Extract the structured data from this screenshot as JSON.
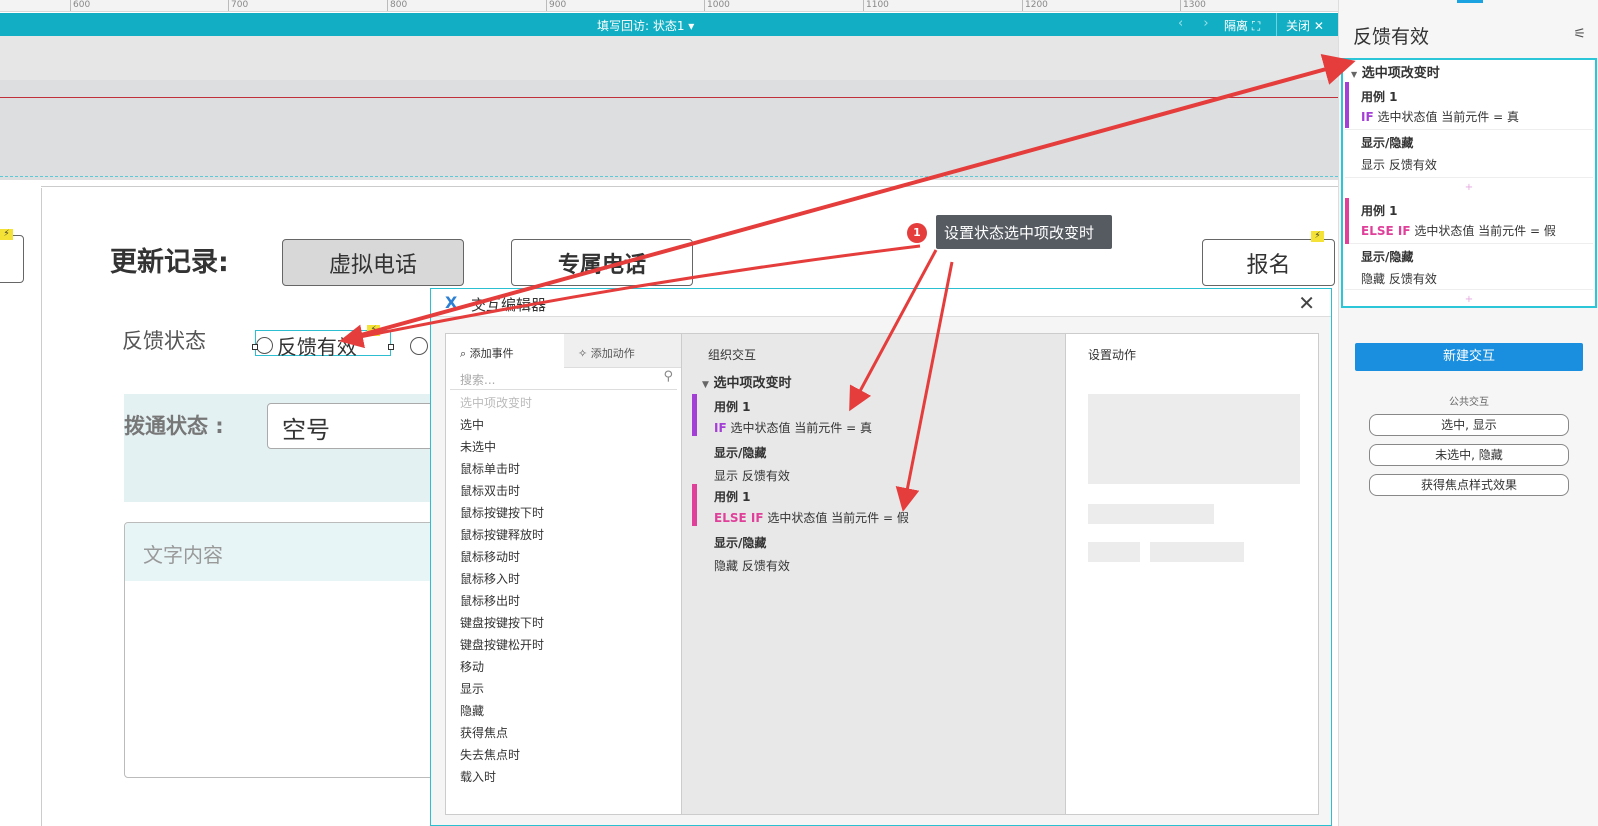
{
  "ruler": {
    "ticks": [
      "600",
      "700",
      "800",
      "900",
      "1000",
      "1100",
      "1200",
      "1300"
    ]
  },
  "topbar": {
    "center_text": "填写回访: 状态1 ▾",
    "nav": "‹ ›",
    "isolate_label": "隔离",
    "close_label": "关闭"
  },
  "canvas": {
    "update_title": "更新记录:",
    "btn_virtual": "虚拟电话",
    "btn_dedicated": "专属电话",
    "btn_signup": "报名",
    "feedback_label": "反馈状态",
    "radio_label": "反馈有效",
    "section_label": "拨通状态 :",
    "select_value": "空号",
    "textarea_placeholder": "文字内容"
  },
  "annotation": {
    "badge": "1",
    "tooltip": "设置状态选中项改变时"
  },
  "dialog": {
    "title": "交互编辑器",
    "tab_add_event": "添加事件",
    "tab_add_action": "添加动作",
    "search_placeholder": "搜索...",
    "events": [
      "选中项改变时",
      "选中",
      "未选中",
      "鼠标单击时",
      "鼠标双击时",
      "鼠标按键按下时",
      "鼠标按键释放时",
      "鼠标移动时",
      "鼠标移入时",
      "鼠标移出时",
      "键盘按键按下时",
      "键盘按键松开时",
      "移动",
      "显示",
      "隐藏",
      "获得焦点",
      "失去焦点时",
      "载入时"
    ],
    "org_header": "组织交互",
    "org_event": "选中项改变时",
    "cases": [
      {
        "name": "用例 1",
        "kw": "IF",
        "cond": " 选中状态值 当前元件 = 真",
        "action": "显示/隐藏",
        "action_detail": "显示 反馈有效",
        "bar_color": "#a33ed6"
      },
      {
        "name": "用例 1",
        "kw": "ELSE IF",
        "cond": " 选中状态值 当前元件 = 假",
        "action": "显示/隐藏",
        "action_detail": "隐藏 反馈有效",
        "bar_color": "#e0409a"
      }
    ],
    "set_header": "设置动作"
  },
  "rpanel": {
    "title": "反馈有效",
    "event": "选中项改变时",
    "plus": "+",
    "new_interaction": "新建交互",
    "public_label": "公共交互",
    "public_buttons": [
      "选中, 显示",
      "未选中, 隐藏",
      "获得焦点样式效果"
    ]
  },
  "colors": {
    "accent_teal": "#12afc4",
    "primary_blue": "#1a8fe0",
    "arrow_red": "#e53c3c"
  }
}
